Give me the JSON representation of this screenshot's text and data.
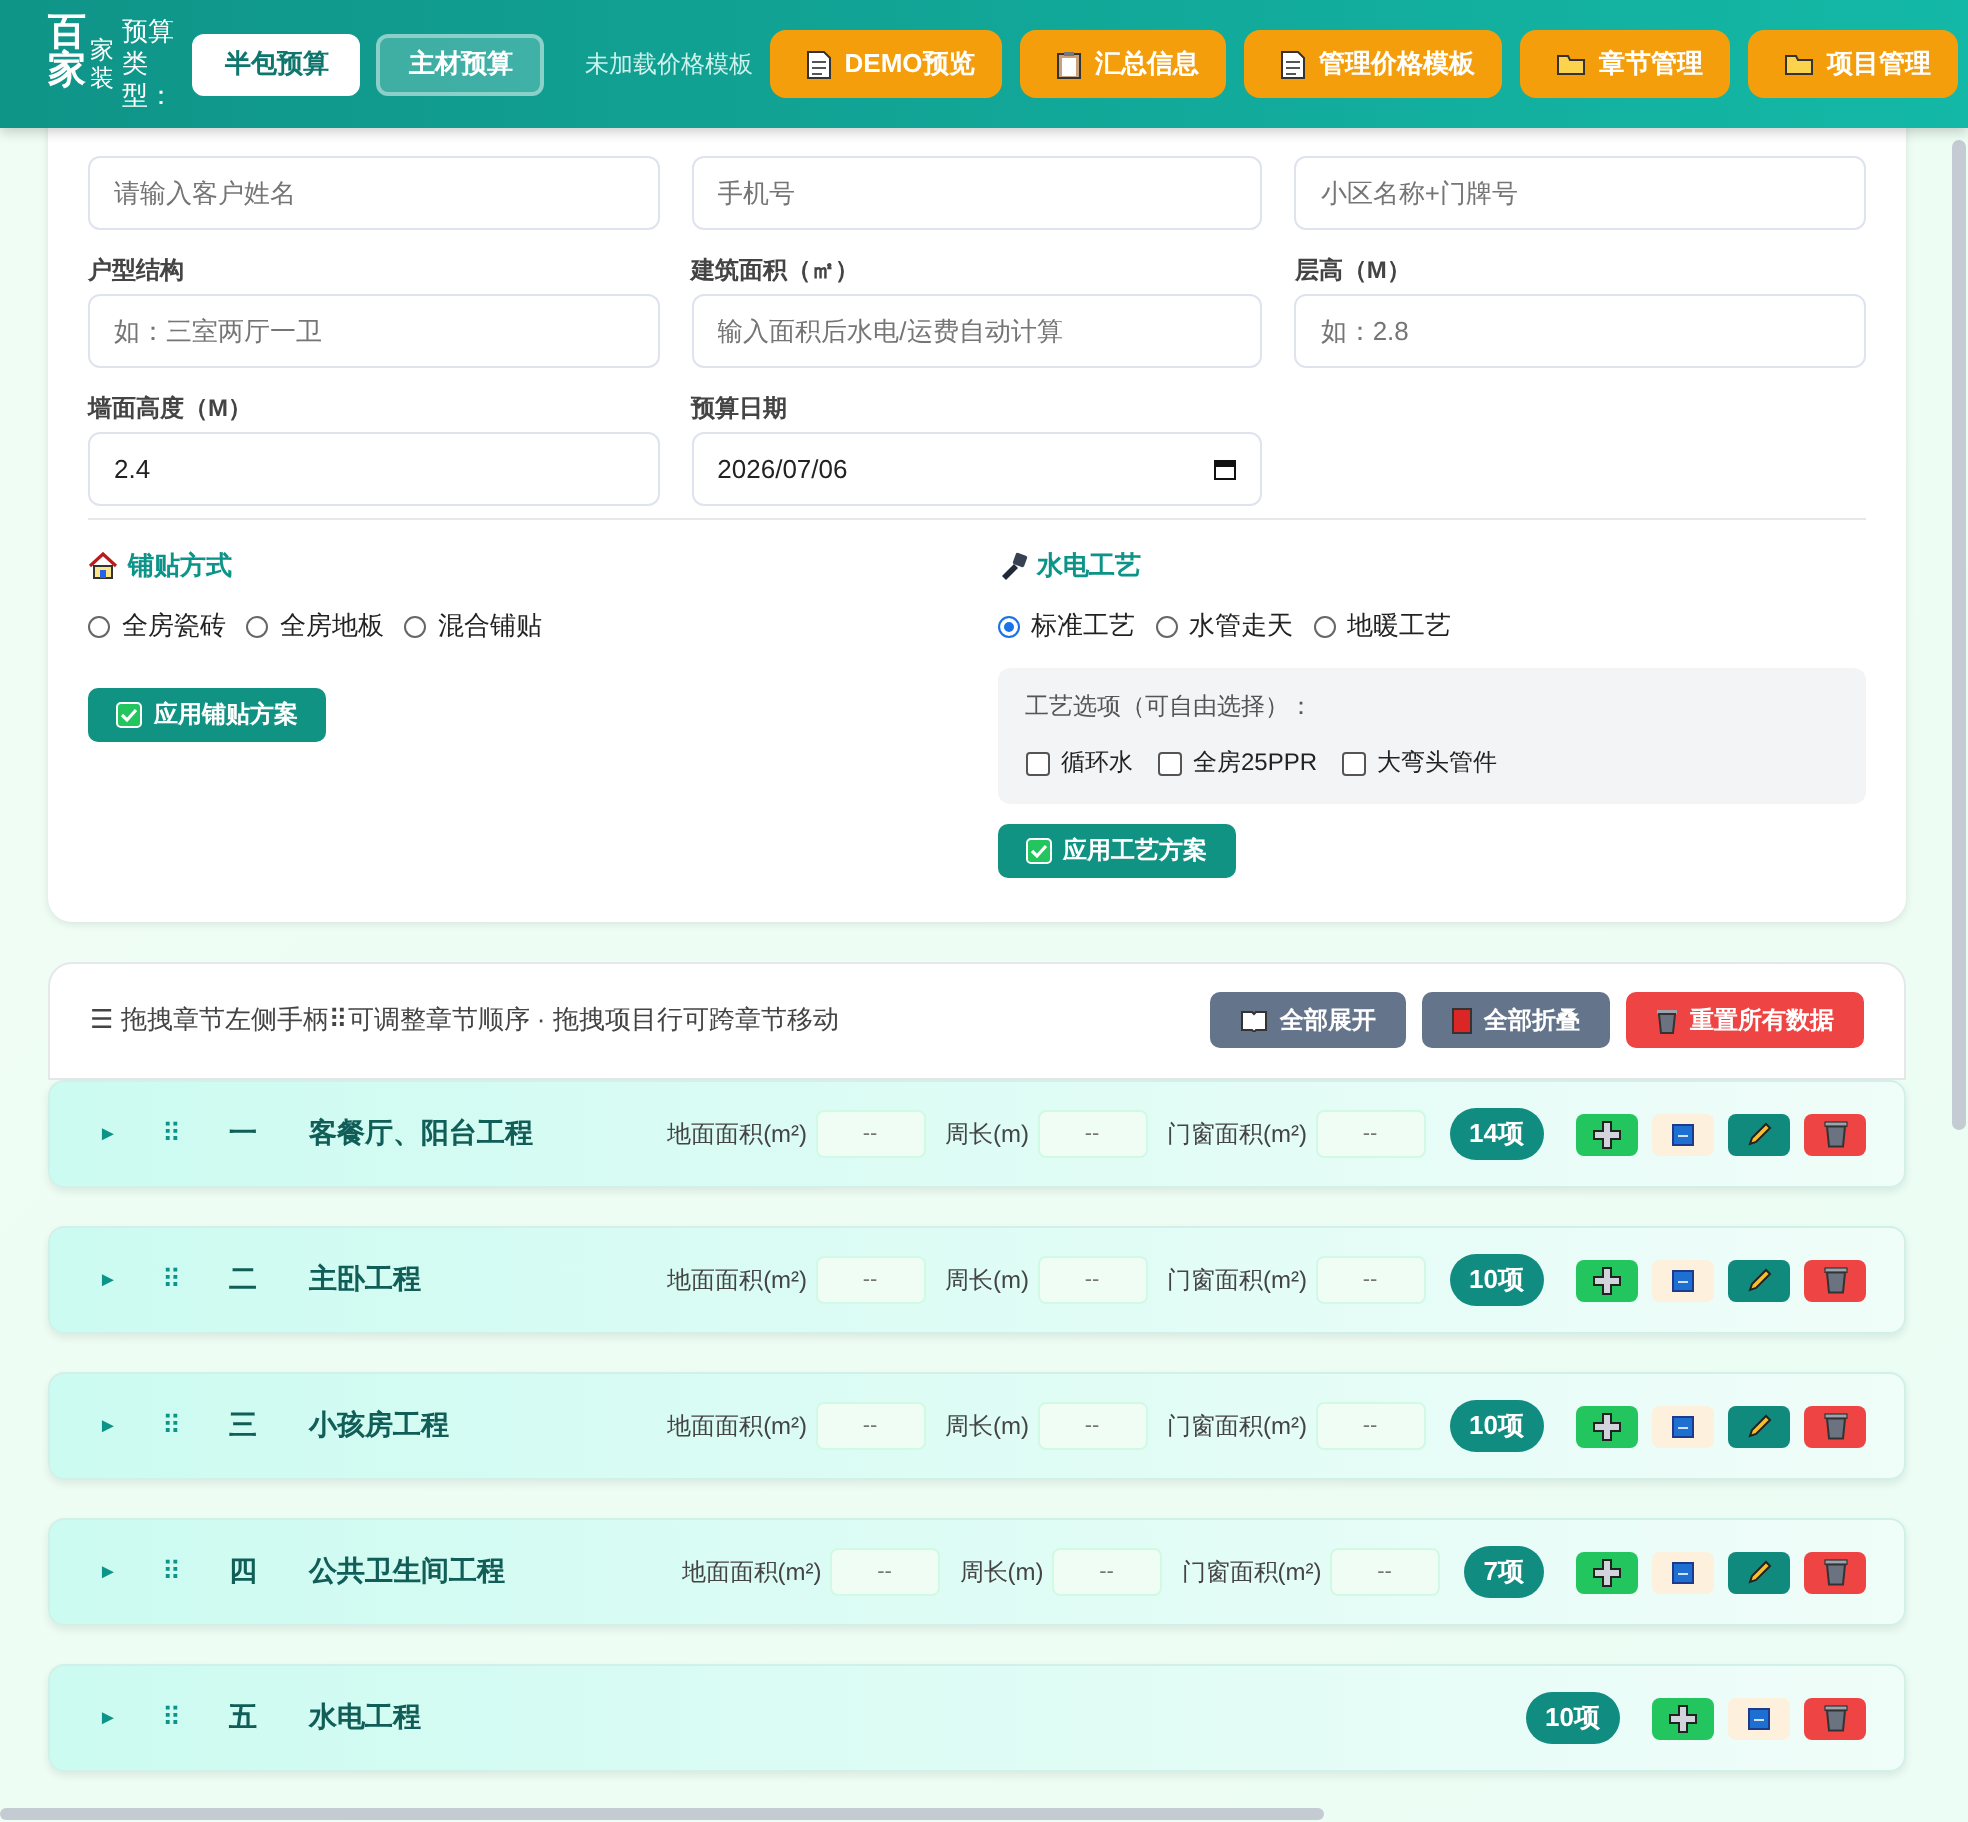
{
  "header": {
    "brand": "百家",
    "brand_sub": "家装",
    "type_label": "预算类型：",
    "type_tabs": [
      {
        "label": "半包预算",
        "selected": true
      },
      {
        "label": "主材预算",
        "selected": false
      }
    ],
    "template_status": "未加载价格模板",
    "actions": [
      "DEMO预览",
      "汇总信息",
      "管理价格模板",
      "章节管理",
      "项目管理"
    ]
  },
  "form": {
    "fields": [
      {
        "placeholder": "请输入客户姓名"
      },
      {
        "placeholder": "手机号"
      },
      {
        "placeholder": "小区名称+门牌号"
      },
      {
        "label": "户型结构",
        "placeholder": "如：三室两厅一卫"
      },
      {
        "label": "建筑面积（㎡）",
        "placeholder": "输入面积后水电/运费自动计算"
      },
      {
        "label": "层高（M）",
        "placeholder": "如：2.8"
      },
      {
        "label": "墙面高度（M）",
        "value": "2.4"
      },
      {
        "label": "预算日期",
        "value": "2026/07/06",
        "kind": "date"
      }
    ],
    "tiling": {
      "title": "铺贴方式",
      "options": [
        {
          "label": "全房瓷砖",
          "selected": false
        },
        {
          "label": "全房地板",
          "selected": false
        },
        {
          "label": "混合铺贴",
          "selected": false
        }
      ],
      "apply_button": "应用铺贴方案"
    },
    "plumbing": {
      "title": "水电工艺",
      "options": [
        {
          "label": "标准工艺",
          "selected": true
        },
        {
          "label": "水管走天",
          "selected": false
        },
        {
          "label": "地暖工艺",
          "selected": false
        }
      ],
      "extras_title": "工艺选项（可自由选择）：",
      "extras": [
        {
          "label": "循环水",
          "checked": false
        },
        {
          "label": "全房25PPR",
          "checked": false
        },
        {
          "label": "大弯头管件",
          "checked": false
        }
      ],
      "apply_button": "应用工艺方案"
    }
  },
  "chapters_toolbar": {
    "hint": "☰ 拖拽章节左侧手柄⠿可调整章节顺序 · 拖拽项目行可跨章节移动",
    "buttons": [
      {
        "label": "全部展开",
        "kind": "expand"
      },
      {
        "label": "全部折叠",
        "kind": "collapse"
      },
      {
        "label": "重置所有数据",
        "kind": "reset"
      }
    ]
  },
  "chapters": [
    {
      "toggle": "►",
      "handle": "⠿",
      "number": "一",
      "name": "客餐厅、阳台工程",
      "fields": [
        {
          "label": "地面面积(m²)",
          "placeholder": "--"
        },
        {
          "label": "周长(m)",
          "placeholder": "--"
        },
        {
          "label": "门窗面积(m²)",
          "placeholder": "--"
        }
      ],
      "count": "14项",
      "buttons": [
        {
          "kind": "add"
        },
        {
          "kind": "rename"
        },
        {
          "kind": "edit"
        },
        {
          "kind": "delete"
        }
      ]
    },
    {
      "toggle": "►",
      "handle": "⠿",
      "number": "二",
      "name": "主卧工程",
      "fields": [
        {
          "label": "地面面积(m²)",
          "placeholder": "--"
        },
        {
          "label": "周长(m)",
          "placeholder": "--"
        },
        {
          "label": "门窗面积(m²)",
          "placeholder": "--"
        }
      ],
      "count": "10项",
      "buttons": [
        {
          "kind": "add"
        },
        {
          "kind": "rename"
        },
        {
          "kind": "edit"
        },
        {
          "kind": "delete"
        }
      ]
    },
    {
      "toggle": "►",
      "handle": "⠿",
      "number": "三",
      "name": "小孩房工程",
      "fields": [
        {
          "label": "地面面积(m²)",
          "placeholder": "--"
        },
        {
          "label": "周长(m)",
          "placeholder": "--"
        },
        {
          "label": "门窗面积(m²)",
          "placeholder": "--"
        }
      ],
      "count": "10项",
      "buttons": [
        {
          "kind": "add"
        },
        {
          "kind": "rename"
        },
        {
          "kind": "edit"
        },
        {
          "kind": "delete"
        }
      ]
    },
    {
      "toggle": "►",
      "handle": "⠿",
      "number": "四",
      "name": "公共卫生间工程",
      "fields": [
        {
          "label": "地面面积(m²)",
          "placeholder": "--"
        },
        {
          "label": "周长(m)",
          "placeholder": "--"
        },
        {
          "label": "门窗面积(m²)",
          "placeholder": "--"
        }
      ],
      "count": "7项",
      "buttons": [
        {
          "kind": "add"
        },
        {
          "kind": "rename"
        },
        {
          "kind": "edit"
        },
        {
          "kind": "delete"
        }
      ]
    },
    {
      "toggle": "►",
      "handle": "⠿",
      "number": "五",
      "name": "水电工程",
      "count": "10项",
      "buttons": [
        {
          "kind": "add"
        },
        {
          "kind": "rename"
        },
        {
          "kind": "delete"
        }
      ]
    }
  ]
}
